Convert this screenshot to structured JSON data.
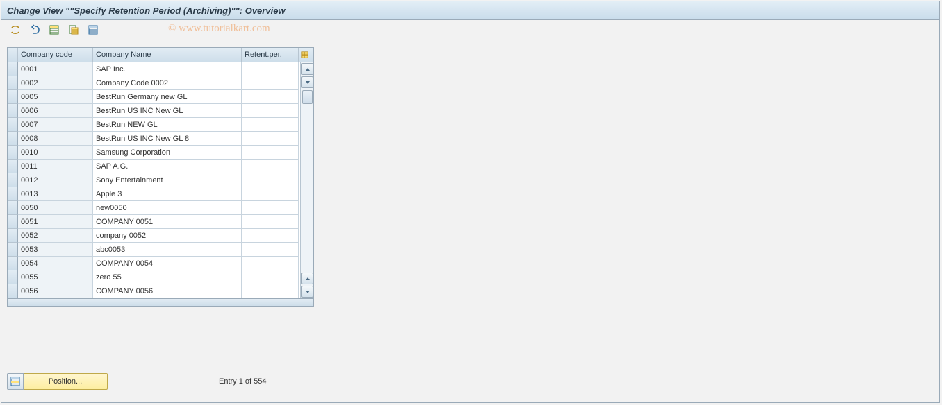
{
  "header": {
    "title": "Change View \"\"Specify Retention Period (Archiving)\"\": Overview"
  },
  "toolbar": {
    "buttons": [
      {
        "name": "change-toggle-icon"
      },
      {
        "name": "undo-icon"
      },
      {
        "name": "new-entries-icon"
      },
      {
        "name": "copy-as-icon"
      },
      {
        "name": "delete-icon"
      }
    ]
  },
  "watermark": "© www.tutorialkart.com",
  "table": {
    "columns": {
      "code": "Company code",
      "name": "Company Name",
      "retention": "Retent.per."
    },
    "config_icon": "table-settings-icon",
    "rows": [
      {
        "code": "0001",
        "name": "SAP Inc.",
        "retention": ""
      },
      {
        "code": "0002",
        "name": "Company Code 0002",
        "retention": ""
      },
      {
        "code": "0005",
        "name": "BestRun Germany new GL",
        "retention": ""
      },
      {
        "code": "0006",
        "name": "BestRun US INC New GL",
        "retention": ""
      },
      {
        "code": "0007",
        "name": "BestRun NEW GL",
        "retention": ""
      },
      {
        "code": "0008",
        "name": "BestRun US INC New GL 8",
        "retention": ""
      },
      {
        "code": "0010",
        "name": "Samsung Corporation",
        "retention": ""
      },
      {
        "code": "0011",
        "name": "SAP A.G.",
        "retention": ""
      },
      {
        "code": "0012",
        "name": "Sony Entertainment",
        "retention": ""
      },
      {
        "code": "0013",
        "name": "Apple 3",
        "retention": ""
      },
      {
        "code": "0050",
        "name": "new0050",
        "retention": ""
      },
      {
        "code": "0051",
        "name": "COMPANY 0051",
        "retention": ""
      },
      {
        "code": "0052",
        "name": "company 0052",
        "retention": ""
      },
      {
        "code": "0053",
        "name": "abc0053",
        "retention": ""
      },
      {
        "code": "0054",
        "name": "COMPANY 0054",
        "retention": ""
      },
      {
        "code": "0055",
        "name": "zero 55",
        "retention": ""
      },
      {
        "code": "0056",
        "name": "COMPANY 0056",
        "retention": ""
      }
    ]
  },
  "footer": {
    "position_button": "Position...",
    "entry_status": "Entry 1 of 554"
  }
}
